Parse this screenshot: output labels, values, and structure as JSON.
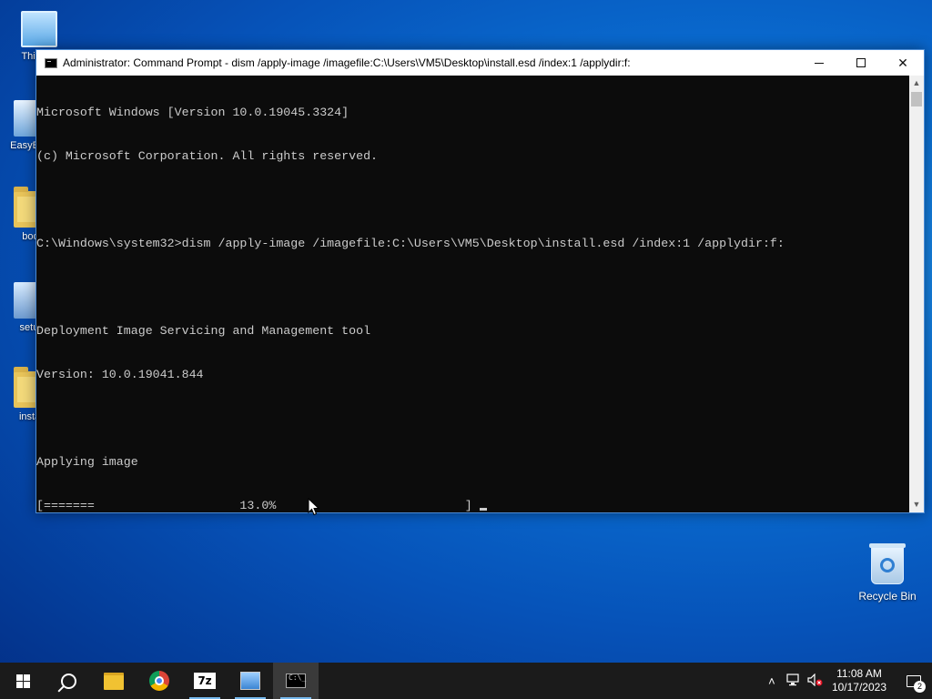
{
  "desktop": {
    "icons": [
      {
        "label": "This PC"
      },
      {
        "label": "EasyBCD"
      },
      {
        "label": "boot"
      },
      {
        "label": "setup"
      },
      {
        "label": "install"
      }
    ],
    "recycle_bin": {
      "label": "Recycle Bin"
    }
  },
  "window": {
    "title": "Administrator: Command Prompt - dism  /apply-image /imagefile:C:\\Users\\VM5\\Desktop\\install.esd /index:1 /applydir:f:",
    "buttons": {
      "minimize": "minimize",
      "maximize": "maximize",
      "close": "✕"
    },
    "console_lines": [
      "Microsoft Windows [Version 10.0.19045.3324]",
      "(c) Microsoft Corporation. All rights reserved.",
      "",
      "C:\\Windows\\system32>dism /apply-image /imagefile:C:\\Users\\VM5\\Desktop\\install.esd /index:1 /applydir:f:",
      "",
      "Deployment Image Servicing and Management tool",
      "Version: 10.0.19041.844",
      "",
      "Applying image"
    ],
    "progress_line": "[=======                    13.0%                          ] ",
    "progress_percent": 13.0
  },
  "taskbar": {
    "apps": [
      {
        "name": "start",
        "active": false
      },
      {
        "name": "search",
        "active": false
      },
      {
        "name": "file-explorer",
        "active": false
      },
      {
        "name": "chrome",
        "active": false
      },
      {
        "name": "7zip",
        "label": "7z",
        "active": false
      },
      {
        "name": "setup",
        "active": false
      },
      {
        "name": "command-prompt",
        "active": true
      }
    ],
    "clock": {
      "time": "11:08 AM",
      "date": "10/17/2023"
    },
    "notification_count": "2",
    "tray_icons": [
      "chevron-up-icon",
      "network-icon",
      "volume-muted-icon"
    ]
  },
  "colors": {
    "console_bg": "#0c0c0c",
    "console_fg": "#cccccc",
    "taskbar_bg": "#1b1b1b",
    "accent": "#76b9ed"
  }
}
